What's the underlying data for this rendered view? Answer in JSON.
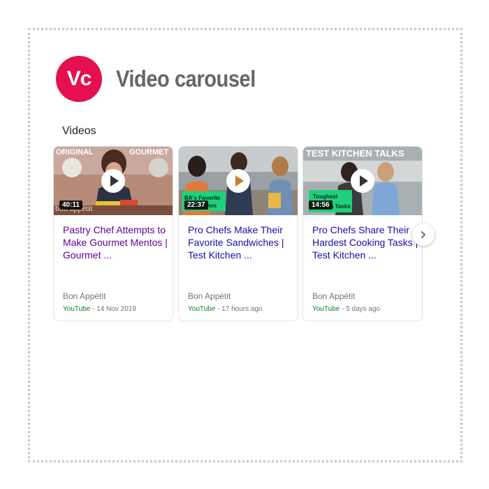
{
  "logo": {
    "text": "Vc"
  },
  "page": {
    "title": "Video carousel"
  },
  "section": {
    "label": "Videos"
  },
  "videos": [
    {
      "duration": "40:11",
      "title": "Pastry Chef Attempts to Make Gourmet Mentos | Gourmet ...",
      "channel": "Bon Appétit",
      "source": "YouTube",
      "date": "14 Nov 2019",
      "visited": true,
      "thumb_text": [
        "ORIGINAL",
        "GOURMET",
        "bon appétit"
      ]
    },
    {
      "duration": "22:37",
      "title": "Pro Chefs Make Their Favorite Sandwiches | Test Kitchen ...",
      "channel": "Bon Appétit",
      "source": "YouTube",
      "date": "17 hours ago",
      "visited": false,
      "thumb_text": [
        "BA's Favorite",
        "Sandwiches"
      ]
    },
    {
      "duration": "14:56",
      "title": "Pro Chefs Share Their Hardest Cooking Tasks | Test Kitchen ...",
      "channel": "Bon Appétit",
      "source": "YouTube",
      "date": "5 days ago",
      "visited": false,
      "thumb_text": [
        "TEST KITCHEN TALKS",
        "Toughest",
        "Kitchen Tasks"
      ]
    }
  ],
  "meta_separator": " - ",
  "colors": {
    "brand": "#e5104f",
    "title_link": "#1a0dab",
    "visited_link": "#660099",
    "source_green": "#0d7c29",
    "muted": "#70757a"
  }
}
